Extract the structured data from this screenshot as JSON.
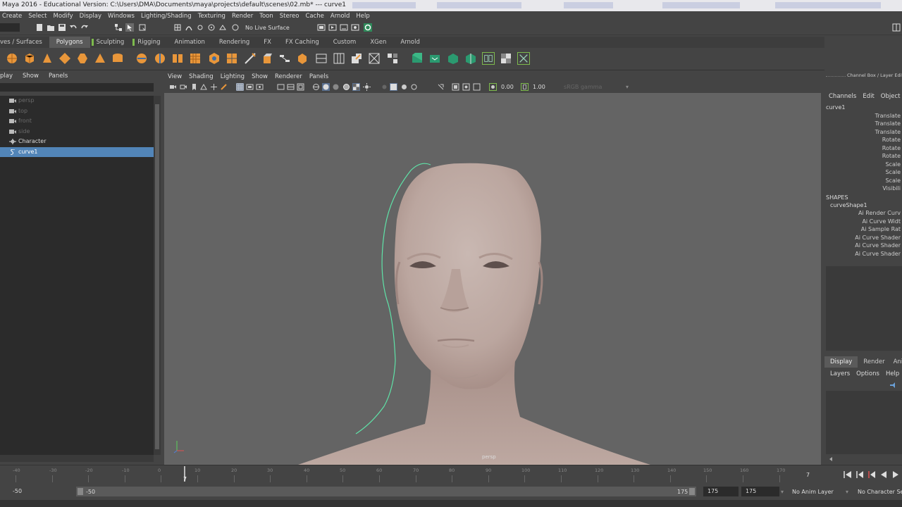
{
  "window": {
    "title": "Maya 2016 - Educational Version: C:\\Users\\DMA\\Documents\\maya\\projects\\default\\scenes\\02.mb*  ---  curve1"
  },
  "menubar": [
    "Create",
    "Select",
    "Modify",
    "Display",
    "Windows",
    "Lighting/Shading",
    "Texturing",
    "Render",
    "Toon",
    "Stereo",
    "Cache",
    "Arnold",
    "Help"
  ],
  "statusline": {
    "live_surface": "No Live Surface"
  },
  "shelf_tabs": [
    "ves / Surfaces",
    "Polygons",
    "Sculpting",
    "Rigging",
    "Animation",
    "Rendering",
    "FX",
    "FX Caching",
    "Custom",
    "XGen",
    "Arnold"
  ],
  "shelf_active": "Polygons",
  "outliner": {
    "menu": [
      "play",
      "Show",
      "Panels"
    ],
    "items": [
      {
        "label": "persp",
        "icon": "camera-icon",
        "state": "dim"
      },
      {
        "label": "top",
        "icon": "camera-icon",
        "state": "dim"
      },
      {
        "label": "front",
        "icon": "camera-icon",
        "state": "dim"
      },
      {
        "label": "side",
        "icon": "camera-icon",
        "state": "dim"
      },
      {
        "label": "Character",
        "icon": "group-icon",
        "state": "normal"
      },
      {
        "label": "curve1",
        "icon": "curve-icon",
        "state": "selected"
      }
    ]
  },
  "viewport": {
    "menu": [
      "View",
      "Shading",
      "Lighting",
      "Show",
      "Renderer",
      "Panels"
    ],
    "near_value": "0.00",
    "far_value": "1.00",
    "color_mode": "sRGB gamma",
    "camera_label": "persp"
  },
  "channel_box": {
    "header": "Channel Box / Layer Editor",
    "menu": [
      "Channels",
      "Edit",
      "Object"
    ],
    "object": "curve1",
    "attributes": [
      "Translate",
      "Translate",
      "Translate",
      "Rotate",
      "Rotate",
      "Rotate",
      "Scale",
      "Scale",
      "Scale",
      "Visibili"
    ],
    "shapes_label": "SHAPES",
    "shape_name": "curveShape1",
    "shape_attributes": [
      "Ai Render Curv",
      "Ai Curve Widt",
      "Ai Sample Rat",
      "Ai Curve Shader",
      "Ai Curve Shader",
      "Ai Curve Shader"
    ]
  },
  "layer_editor": {
    "tabs": [
      "Display",
      "Render",
      "Ani"
    ],
    "active_tab": "Display",
    "menu": [
      "Layers",
      "Options",
      "Help"
    ]
  },
  "timeline": {
    "labels": [
      "-40",
      "-30",
      "-20",
      "-10",
      "0",
      "10",
      "20",
      "30",
      "40",
      "50",
      "60",
      "70",
      "80",
      "90",
      "100",
      "110",
      "120",
      "130",
      "140",
      "150",
      "160",
      "170"
    ],
    "current_frame": "7",
    "frame_field": "7"
  },
  "range": {
    "start": "-50",
    "anim_start": "-50",
    "anim_end": "175",
    "end_field": "175",
    "end_field2": "175",
    "anim_layer": "No Anim Layer",
    "character_set": "No Character Set"
  }
}
